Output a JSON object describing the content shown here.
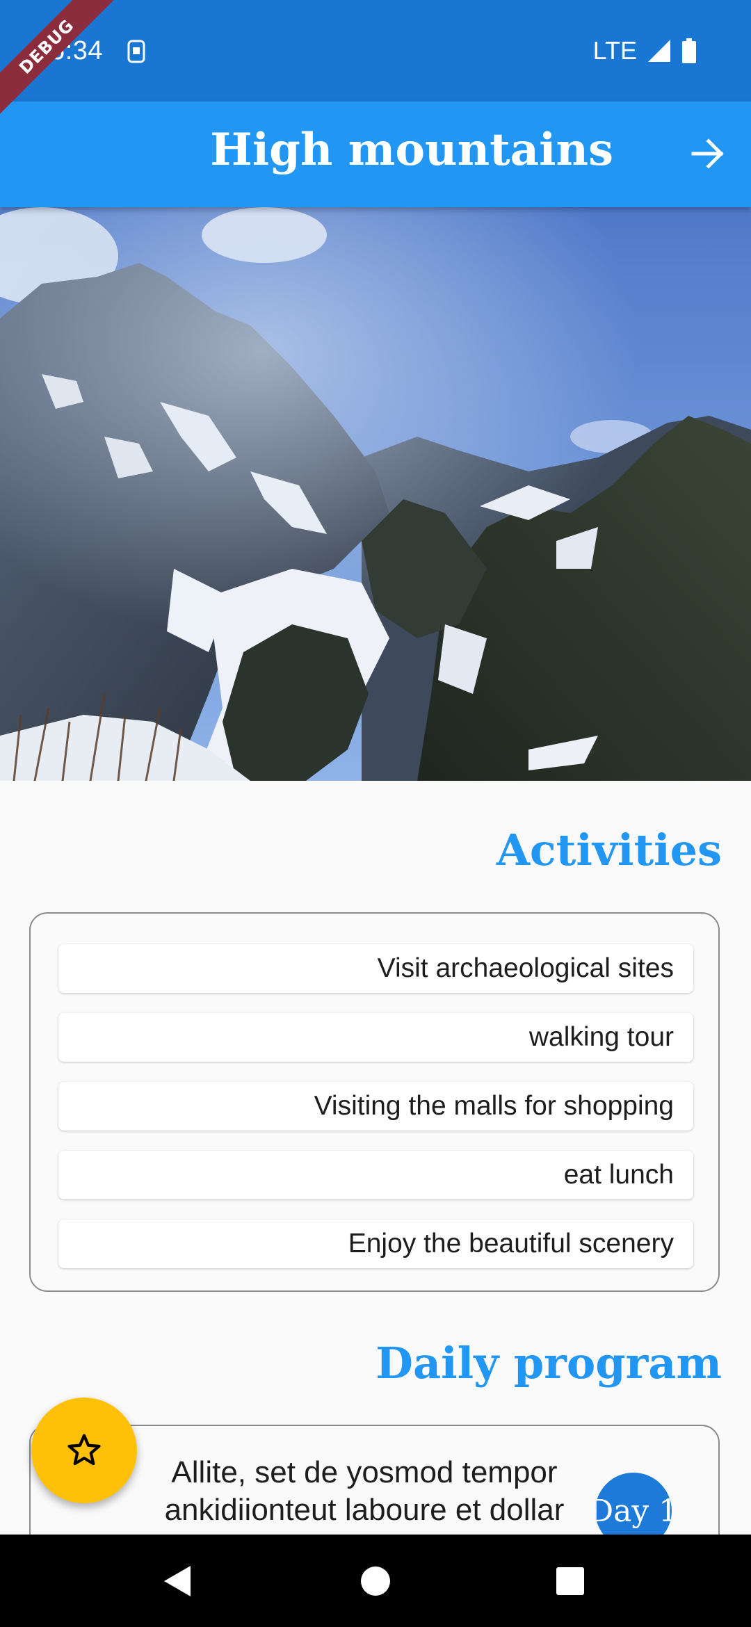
{
  "status_bar": {
    "time": "6:34",
    "network": "LTE",
    "debug_label": "DEBUG"
  },
  "app_bar": {
    "title": "High mountains",
    "forward_icon": "arrow-right-icon"
  },
  "hero": {
    "image_description_icon": "mountain-photo"
  },
  "activities": {
    "title": "Activities",
    "items": [
      "Visit archaeological sites",
      "walking tour",
      "Visiting the malls for shopping",
      "eat lunch",
      "Enjoy the beautiful scenery"
    ]
  },
  "daily_program": {
    "title": "Daily program",
    "entries": [
      {
        "text": "Allite, set de yosmod tempor ankidiionteut laboure et dollar",
        "day": "Day 1"
      }
    ]
  },
  "fab": {
    "icon": "star-outline-icon"
  },
  "colors": {
    "status_bar": "#1976d2",
    "app_bar": "#2196f3",
    "accent_title": "#2196f3",
    "fab": "#ffc107",
    "day_badge": "#1e7ad8"
  }
}
